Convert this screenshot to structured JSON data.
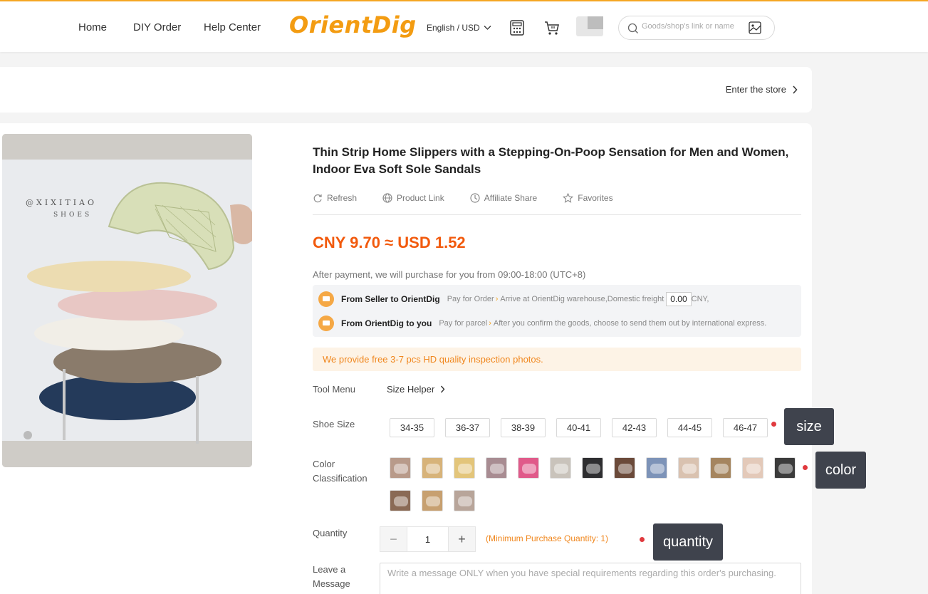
{
  "header": {
    "nav": [
      "Home",
      "DIY Order",
      "Help Center"
    ],
    "logo_text": "OrientDig",
    "language": "English",
    "currency": "USD",
    "search_placeholder": "Goods/shop's link or name"
  },
  "store": {
    "enter_label": "Enter the store"
  },
  "product": {
    "title": "Thin Strip Home Slippers with a Stepping-On-Poop Sensation for Men and Women, Indoor Eva Soft Sole Sandals",
    "actions": [
      "Refresh",
      "Product Link",
      "Affiliate Share",
      "Favorites"
    ],
    "price": "CNY 9.70 ≈ USD 1.52",
    "after_payment": "After payment, we will purchase for you from 09:00-18:00 (UTC+8)",
    "flow": [
      {
        "title": "From Seller to OrientDig",
        "pay": "Pay for Order",
        "desc": "Arrive at OrientDig warehouse,Domestic freight",
        "freight": "0.00",
        "unit": "CNY,"
      },
      {
        "title": "From OrientDig to you",
        "pay": "Pay for parcel",
        "desc": "After you confirm the goods, choose to send them out by international express."
      }
    ],
    "notice": "We provide free 3-7 pcs HD quality inspection photos.",
    "tool_menu_label": "Tool Menu",
    "size_helper": "Size Helper",
    "shoe_size_label": "Shoe Size",
    "sizes": [
      "34-35",
      "36-37",
      "38-39",
      "40-41",
      "42-43",
      "44-45",
      "46-47"
    ],
    "color_label": "Color Classification",
    "swatch_colors": [
      "#b89a8a",
      "#d7b37a",
      "#e3c57a",
      "#a88c92",
      "#e05a8a",
      "#c9c3bb",
      "#2e2e30",
      "#6b4a3a",
      "#7d93b8",
      "#d9c2b0",
      "#a5855f",
      "#e3c9b9",
      "#3b3b3b",
      "#8a6a55",
      "#c7a070",
      "#b8a59a"
    ],
    "quantity_label": "Quantity",
    "quantity": "1",
    "min_qty": "(Minimum Purchase Quantity: 1)",
    "message_label": "Leave a Message",
    "message_placeholder": "Write a message ONLY when you have special requirements regarding this order's purchasing."
  },
  "annotations": [
    "size",
    "color",
    "quantity"
  ],
  "colors": {
    "accent": "#f25a0d",
    "orange": "#f0871e",
    "tag_bg": "#3f434d"
  }
}
